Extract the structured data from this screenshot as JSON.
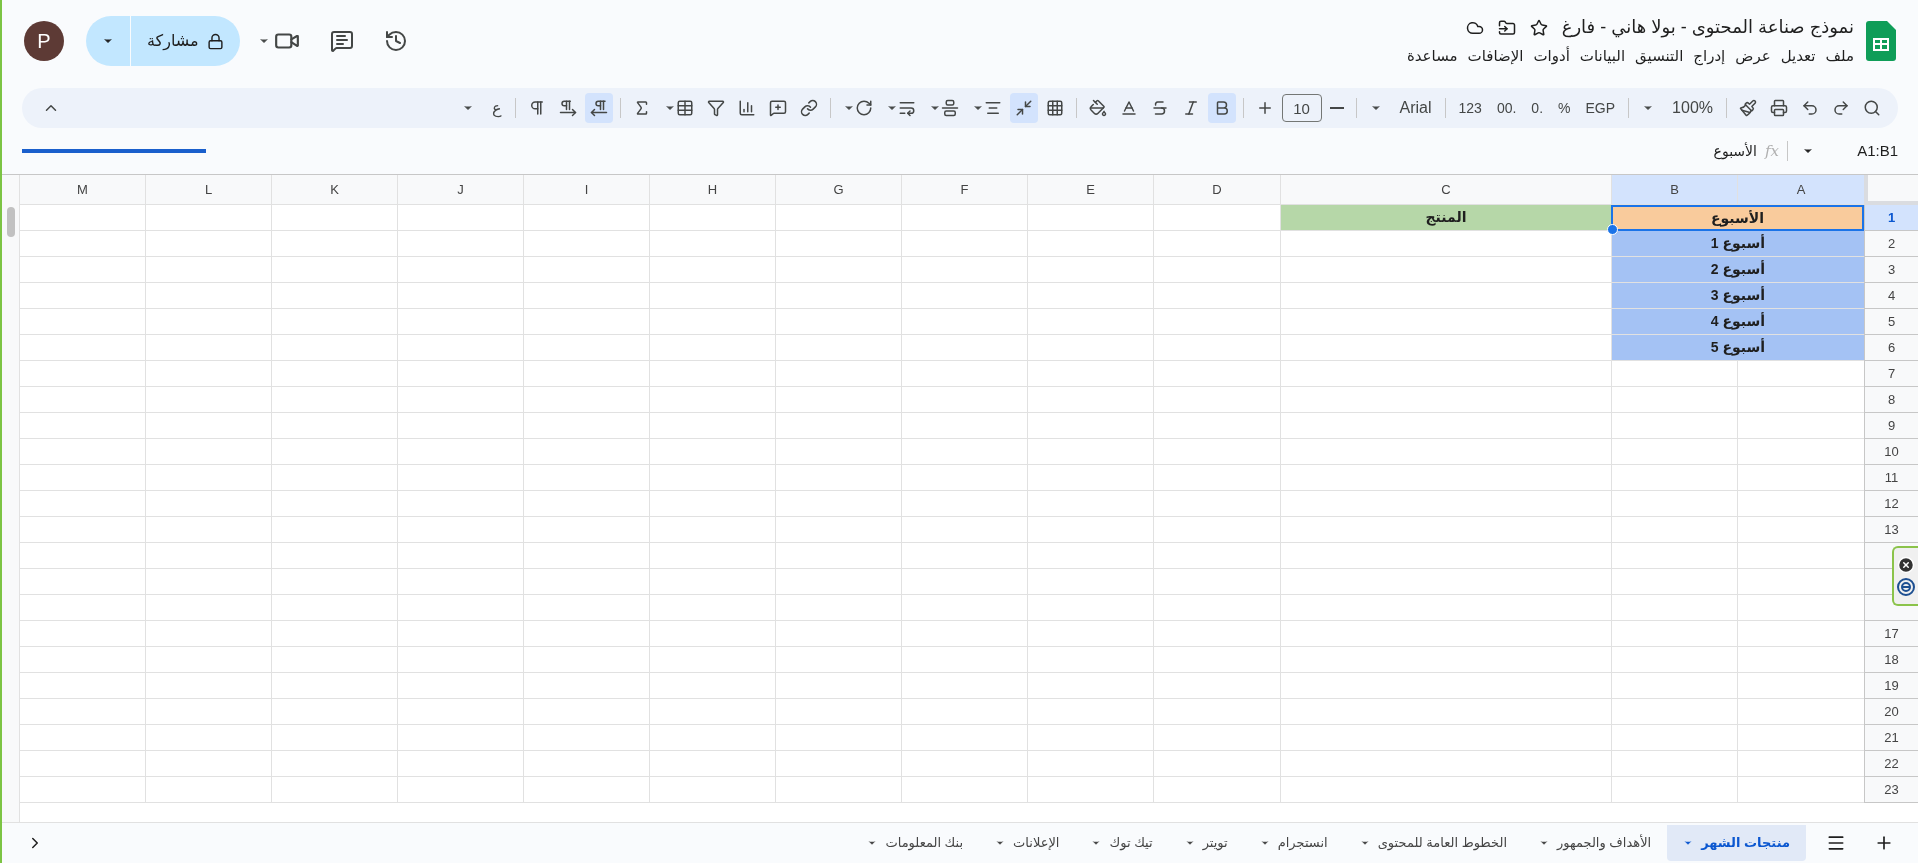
{
  "header": {
    "title": "نموذج صناعة المحتوى - بولا هاني - فارغ",
    "starred": false,
    "share_label": "مشاركة",
    "avatar": "P"
  },
  "menu": [
    "ملف",
    "تعديل",
    "عرض",
    "إدراج",
    "التنسيق",
    "البيانات",
    "أدوات",
    "الإضافات",
    "مساعدة"
  ],
  "toolbar": [
    {
      "kind": "icon",
      "selected": false
    },
    {
      "kind": "icon",
      "selected": false
    },
    {
      "kind": "icon",
      "selected": false
    },
    {
      "kind": "icon",
      "selected": false
    },
    {
      "kind": "icon",
      "selected": false
    },
    {
      "kind": "divider"
    },
    {
      "kind": "menu",
      "label": "100%"
    },
    {
      "kind": "divider"
    },
    {
      "kind": "text",
      "label": "EGP"
    },
    {
      "kind": "text",
      "label": "%"
    },
    {
      "kind": "text",
      "label": ".0"
    },
    {
      "kind": "text",
      "label": ".00"
    },
    {
      "kind": "text",
      "label": "123"
    },
    {
      "kind": "divider"
    },
    {
      "kind": "menu",
      "label": "Arial"
    },
    {
      "kind": "divider"
    },
    {
      "kind": "icon",
      "selected": false
    },
    {
      "kind": "field",
      "value": "10"
    },
    {
      "kind": "icon",
      "selected": false
    },
    {
      "kind": "divider"
    },
    {
      "kind": "icon",
      "selected": true
    },
    {
      "kind": "icon",
      "selected": false
    },
    {
      "kind": "icon",
      "selected": false
    },
    {
      "kind": "icon",
      "selected": false
    },
    {
      "kind": "icon",
      "selected": false
    },
    {
      "kind": "divider"
    },
    {
      "kind": "icon",
      "selected": false
    },
    {
      "kind": "icon",
      "selected": true
    },
    {
      "kind": "icon_menu",
      "selected": false
    },
    {
      "kind": "icon_menu",
      "selected": false
    },
    {
      "kind": "icon_menu",
      "selected": false
    },
    {
      "kind": "icon_menu",
      "selected": false
    },
    {
      "kind": "divider"
    },
    {
      "kind": "icon",
      "selected": false
    },
    {
      "kind": "icon",
      "selected": false
    },
    {
      "kind": "icon",
      "selected": false
    },
    {
      "kind": "icon",
      "selected": false
    },
    {
      "kind": "icon_menu",
      "selected": false
    },
    {
      "kind": "icon",
      "selected": false
    },
    {
      "kind": "divider"
    },
    {
      "kind": "icon",
      "selected": true
    },
    {
      "kind": "icon",
      "selected": false
    },
    {
      "kind": "icon",
      "selected": false
    },
    {
      "kind": "divider"
    },
    {
      "kind": "menu",
      "label": "ع"
    }
  ],
  "formula_bar": {
    "name_box": "A1:B1",
    "fx_label": "fx",
    "content": "الأسبوع"
  },
  "columns": [
    {
      "label": "A",
      "selected": true
    },
    {
      "label": "B",
      "selected": true
    },
    {
      "label": "C",
      "selected": false
    },
    {
      "label": "D",
      "selected": false
    },
    {
      "label": "E",
      "selected": false
    },
    {
      "label": "F",
      "selected": false
    },
    {
      "label": "G",
      "selected": false
    },
    {
      "label": "H",
      "selected": false
    },
    {
      "label": "I",
      "selected": false
    },
    {
      "label": "J",
      "selected": false
    },
    {
      "label": "K",
      "selected": false
    },
    {
      "label": "L",
      "selected": false
    },
    {
      "label": "M",
      "selected": false
    }
  ],
  "rows": [
    {
      "number": "1",
      "selected": true,
      "merged_a_b": {
        "text": "الأسبوع",
        "color": "#f9cb9c",
        "selected": true
      },
      "c": {
        "text": "المنتج",
        "color": "#b6d7a8",
        "selected": false
      }
    },
    {
      "number": "2",
      "selected": false,
      "merged_a_b": {
        "text": "أسبوع 1",
        "color": "#a4c2f4",
        "selected": false
      }
    },
    {
      "number": "3",
      "selected": false,
      "merged_a_b": {
        "text": "أسبوع 2",
        "color": "#a4c2f4",
        "selected": false
      }
    },
    {
      "number": "4",
      "selected": false,
      "merged_a_b": {
        "text": "أسبوع 3",
        "color": "#a4c2f4",
        "selected": false
      }
    },
    {
      "number": "5",
      "selected": false,
      "merged_a_b": {
        "text": "أسبوع 4",
        "color": "#a4c2f4",
        "selected": false
      }
    },
    {
      "number": "6",
      "selected": false,
      "merged_a_b": {
        "text": "أسبوع 5",
        "color": "#a4c2f4",
        "selected": false
      }
    },
    {
      "number": "7",
      "selected": false
    },
    {
      "number": "8",
      "selected": false
    },
    {
      "number": "9",
      "selected": false
    },
    {
      "number": "10",
      "selected": false
    },
    {
      "number": "11",
      "selected": false
    },
    {
      "number": "12",
      "selected": false
    },
    {
      "number": "13",
      "selected": false
    },
    {
      "selected": false
    },
    {
      "selected": false
    },
    {
      "selected": false
    },
    {
      "number": "17",
      "selected": false
    },
    {
      "number": "18",
      "selected": false
    },
    {
      "number": "19",
      "selected": false
    },
    {
      "number": "20",
      "selected": false
    },
    {
      "number": "21",
      "selected": false
    },
    {
      "number": "22",
      "selected": false
    },
    {
      "number": "23",
      "selected": false
    }
  ],
  "sheet_tabs": [
    {
      "label": "منتجات الشهر",
      "selected": true
    },
    {
      "label": "الأهداف والجمهور",
      "selected": false
    },
    {
      "label": "الخطوط العامة للمحتوى",
      "selected": false
    },
    {
      "label": "انستجرام",
      "selected": false
    },
    {
      "label": "تويتر",
      "selected": false
    },
    {
      "label": "تيك توك",
      "selected": false
    },
    {
      "label": "الإعلانات",
      "selected": false
    },
    {
      "label": "بنك المعلومات",
      "selected": false
    }
  ]
}
